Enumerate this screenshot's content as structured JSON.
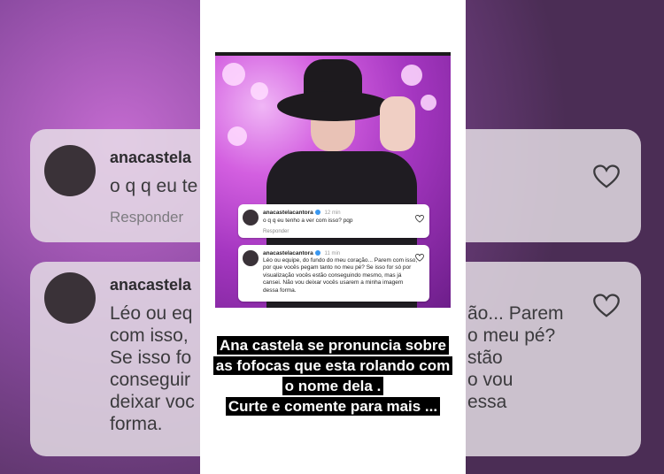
{
  "background": {
    "card1": {
      "username": "anacastela",
      "text": "o q q eu te",
      "reply": "Responder"
    },
    "card2": {
      "username": "anacastela",
      "lines": [
        "Léo ou eq",
        "com isso,",
        "Se isso fo",
        "conseguir",
        "deixar voc",
        "forma."
      ],
      "right_lines": [
        "ão... Parem",
        "o meu pé?",
        "stão",
        "o vou",
        "essa"
      ]
    }
  },
  "comment1": {
    "username": "anacastelacantora",
    "time": "12 min",
    "text": "o q q eu tenho a ver com isso? pqp",
    "reply": "Responder"
  },
  "comment2": {
    "username": "anacastelacantora",
    "time": "11 min",
    "text": "Léo ou equipe, do fundo do meu coração... Parem com isso, por que vocês pegam tanto no meu pé? Se isso for só por visualização vocês estão conseguindo mesmo, mas já cansei. Não vou deixar vocês usarem a minha imagem dessa forma."
  },
  "caption": {
    "line1": "Ana castela se pronuncia sobre",
    "line2": "as fofocas que esta rolando com",
    "line3": "o nome dela .",
    "line4": "Curte e comente para mais ..."
  },
  "icons": {
    "heart": "heart-icon",
    "verified": "verified-badge-icon"
  },
  "colors": {
    "accent_photo": "#c44fd8",
    "verified": "#3897f0"
  }
}
